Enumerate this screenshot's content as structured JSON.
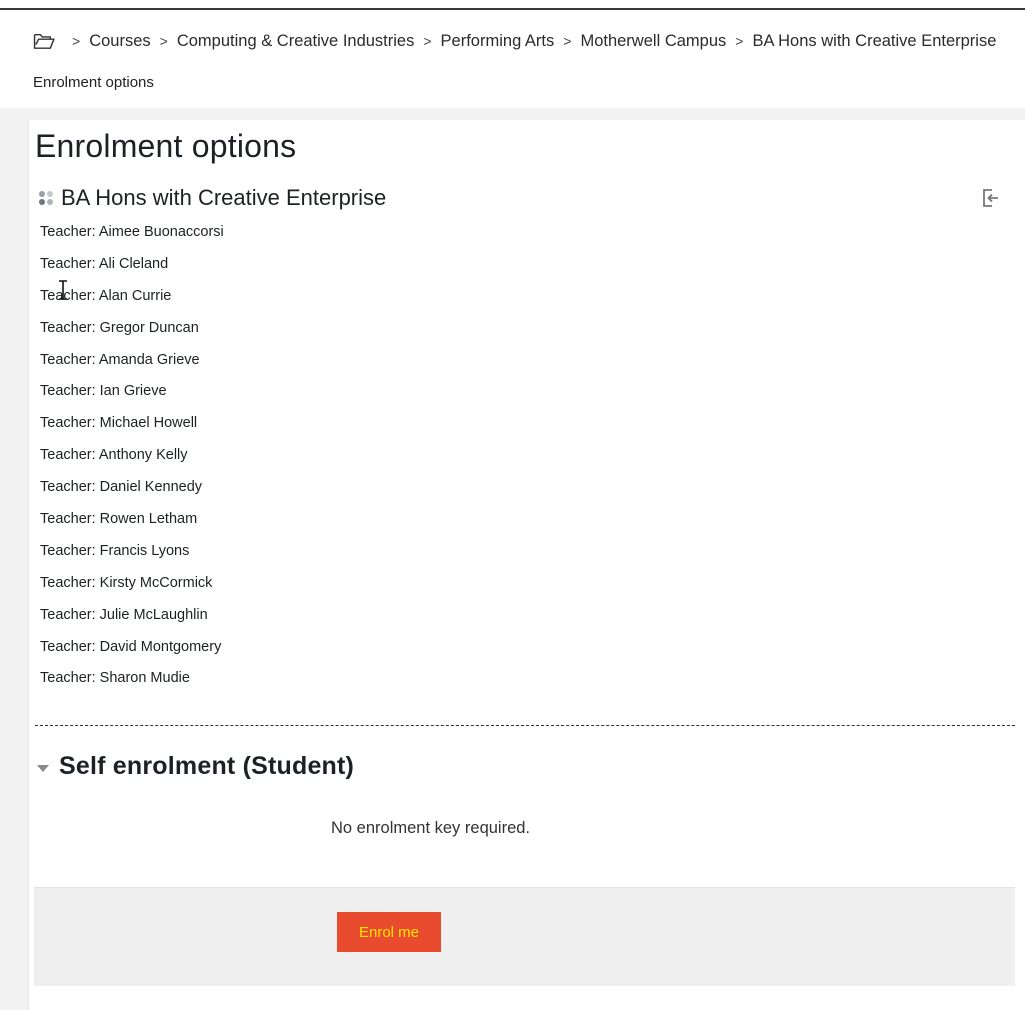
{
  "breadcrumb": {
    "home_icon": "folder-icon",
    "items": [
      "Courses",
      "Computing & Creative Industries",
      "Performing Arts",
      "Motherwell Campus",
      "BA Hons with Creative Enterprise"
    ]
  },
  "page_subtitle": "Enrolment options",
  "page_title": "Enrolment options",
  "course": {
    "name": "BA Hons with Creative Enterprise",
    "icon": "course-icon",
    "action_icon": "enrol-sign-in-icon"
  },
  "teachers": [
    "Teacher: Aimee Buonaccorsi",
    "Teacher: Ali Cleland",
    "Teacher: Alan Currie",
    "Teacher: Gregor Duncan",
    "Teacher: Amanda Grieve",
    "Teacher: Ian Grieve",
    "Teacher: Michael Howell",
    "Teacher: Anthony Kelly",
    "Teacher: Daniel Kennedy",
    "Teacher: Rowen Letham",
    "Teacher: Francis Lyons",
    "Teacher: Kirsty McCormick",
    "Teacher: Julie McLaughlin",
    "Teacher: David Montgomery",
    "Teacher: Sharon Mudie"
  ],
  "self_enrolment": {
    "title": "Self enrolment (Student)",
    "message": "No enrolment key required.",
    "button_label": "Enrol me"
  },
  "colors": {
    "button_bg": "#e94b2e",
    "button_text": "#ffe600"
  }
}
